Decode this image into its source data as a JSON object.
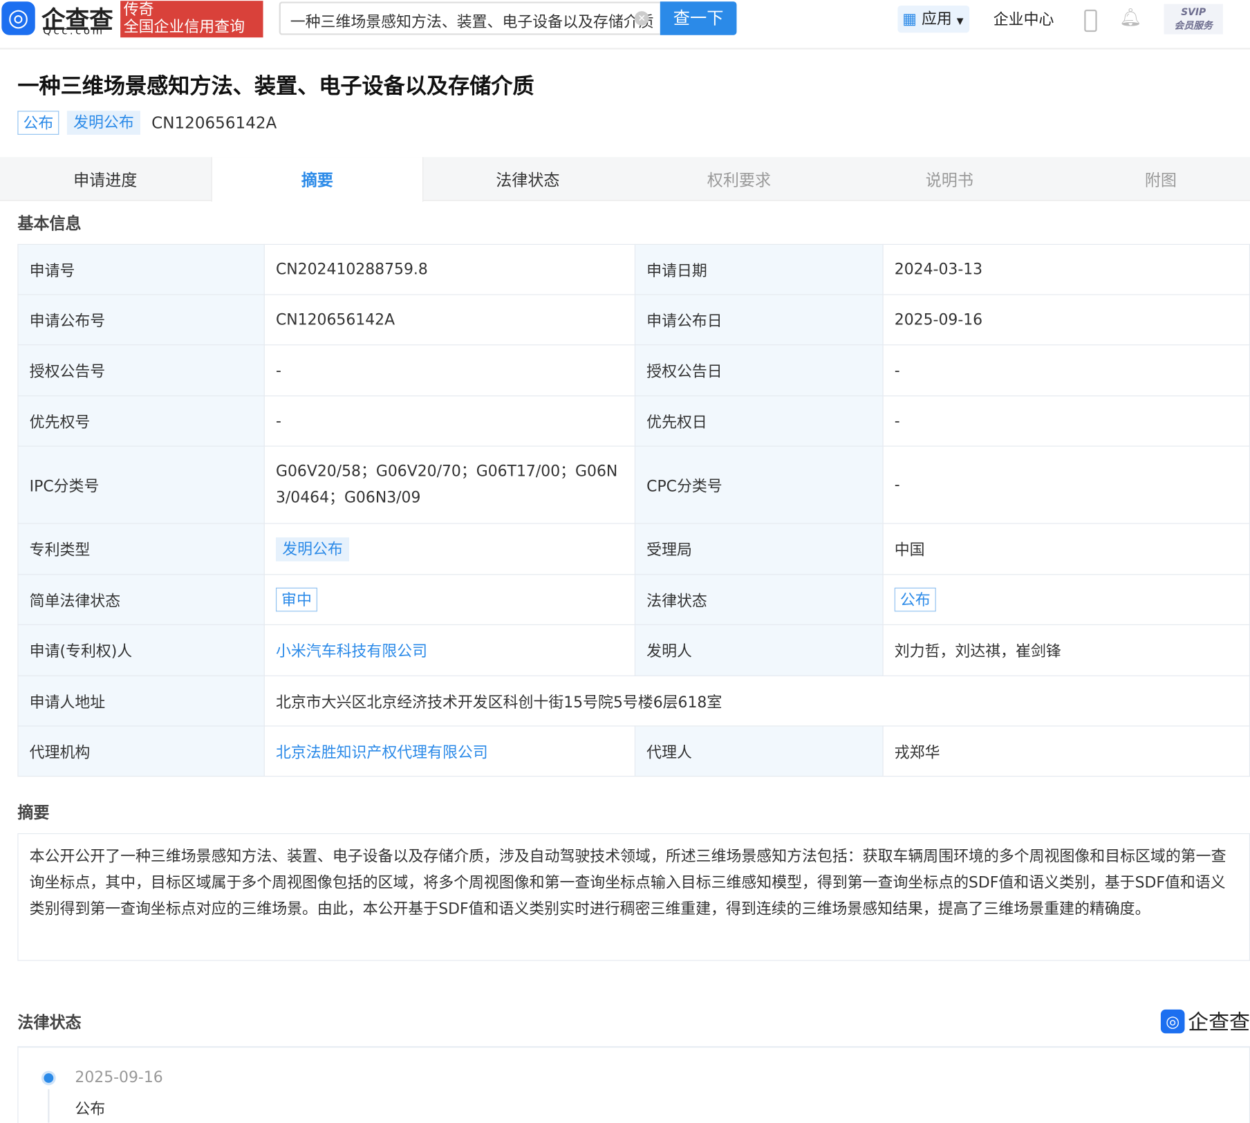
{
  "header": {
    "logo_text": "企查查",
    "logo_sub": "Qcc.com",
    "promo_line1": "传奇",
    "promo_line2": "全国企业信用查询",
    "search_value": "一种三维场景感知方法、装置、电子设备以及存储介质",
    "search_button": "查一下",
    "apps": "应用",
    "enterprise_center": "企业中心",
    "svip": "SVIP",
    "svip_sub": "会员服务"
  },
  "patent": {
    "title": "一种三维场景感知方法、装置、电子设备以及存储介质",
    "tags": [
      "公布",
      "发明公布"
    ],
    "number": "CN120656142A"
  },
  "tabs": [
    "申请进度",
    "摘要",
    "法律状态",
    "权利要求",
    "说明书",
    "附图"
  ],
  "basic": {
    "heading": "基本信息",
    "rows": [
      {
        "k1": "申请号",
        "v1": "CN202410288759.8",
        "k2": "申请日期",
        "v2": "2024-03-13"
      },
      {
        "k1": "申请公布号",
        "v1": "CN120656142A",
        "k2": "申请公布日",
        "v2": "2025-09-16"
      },
      {
        "k1": "授权公告号",
        "v1": "-",
        "k2": "授权公告日",
        "v2": "-"
      },
      {
        "k1": "优先权号",
        "v1": "-",
        "k2": "优先权日",
        "v2": "-"
      },
      {
        "k1": "IPC分类号",
        "v1": "G06V20/58；G06V20/70；G06T17/00；G06N3/0464；G06N3/09",
        "k2": "CPC分类号",
        "v2": "-"
      },
      {
        "k1": "专利类型",
        "v1": "发明公布",
        "k2": "受理局",
        "v2": "中国"
      },
      {
        "k1": "简单法律状态",
        "v1": "审中",
        "k2": "法律状态",
        "v2": "公布"
      },
      {
        "k1": "申请(专利权)人",
        "v1": "小米汽车科技有限公司",
        "k2": "发明人",
        "v2": "刘力哲，刘达祺，崔剑锋"
      },
      {
        "k1": "申请人地址",
        "v1": "北京市大兴区北京经济技术开发区科创十街15号院5号楼6层618室"
      },
      {
        "k1": "代理机构",
        "v1": "北京法胜知识产权代理有限公司",
        "k2": "代理人",
        "v2": "戎郑华"
      }
    ]
  },
  "abstract": {
    "heading": "摘要",
    "text": "本公开公开了一种三维场景感知方法、装置、电子设备以及存储介质，涉及自动驾驶技术领域，所述三维场景感知方法包括：获取车辆周围环境的多个周视图像和目标区域的第一查询坐标点，其中，目标区域属于多个周视图像包括的区域，将多个周视图像和第一查询坐标点输入目标三维感知模型，得到第一查询坐标点的SDF值和语义类别，基于SDF值和语义类别得到第一查询坐标点对应的三维场景。由此，本公开基于SDF值和语义类别实时进行稠密三维重建，得到连续的三维场景感知结果，提高了三维场景重建的精确度。"
  },
  "legal": {
    "heading": "法律状态",
    "watermark": "企查查",
    "events": [
      {
        "date": "2025-09-16",
        "status": "公布"
      }
    ]
  }
}
